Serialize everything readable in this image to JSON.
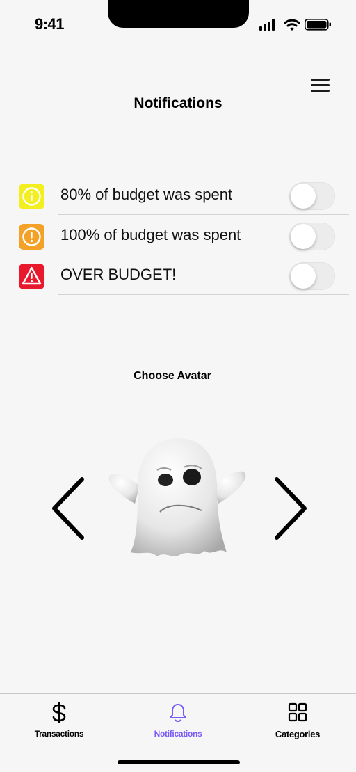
{
  "status_bar": {
    "time": "9:41"
  },
  "header": {
    "title": "Notifications",
    "menu_icon": "hamburger-menu-icon"
  },
  "notifications": [
    {
      "label": "80% of budget was spent",
      "icon": "info-icon",
      "color": "#f2ee1f",
      "enabled": false
    },
    {
      "label": "100% of budget was spent",
      "icon": "exclamation-icon",
      "color": "#f4a127",
      "enabled": false
    },
    {
      "label": "OVER BUDGET!",
      "icon": "warning-triangle-icon",
      "color": "#e8192c",
      "enabled": false
    }
  ],
  "avatar_section": {
    "title": "Choose Avatar",
    "current_avatar": "ghost"
  },
  "tab_bar": {
    "tabs": [
      {
        "label": "Transactions",
        "icon": "dollar-icon",
        "color": "#000000",
        "active": false
      },
      {
        "label": "Notifications",
        "icon": "bell-icon",
        "color": "#7a5af8",
        "active": true
      },
      {
        "label": "Categories",
        "icon": "grid-icon",
        "color": "#000000",
        "active": false
      }
    ]
  },
  "colors": {
    "accent": "#7a5af8",
    "background": "#f6f6f6"
  }
}
